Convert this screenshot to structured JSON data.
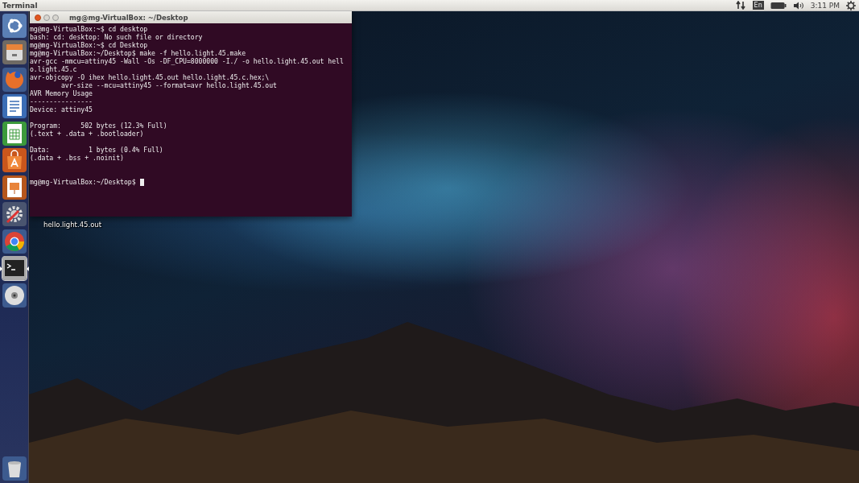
{
  "top_bar": {
    "app_title": "Terminal",
    "keyboard_layout": "En",
    "clock": "3:11 PM"
  },
  "launcher": {
    "items": [
      {
        "kind": "dash",
        "running": false
      },
      {
        "kind": "files",
        "running": false
      },
      {
        "kind": "firefox",
        "running": false
      },
      {
        "kind": "writer",
        "running": false
      },
      {
        "kind": "calc",
        "running": false
      },
      {
        "kind": "software",
        "running": false
      },
      {
        "kind": "impress",
        "running": false
      },
      {
        "kind": "settings",
        "running": false
      },
      {
        "kind": "chrome",
        "running": false
      },
      {
        "kind": "terminal",
        "running": true
      },
      {
        "kind": "dvd",
        "running": false
      },
      {
        "kind": "trash",
        "running": false
      }
    ]
  },
  "desktop": {
    "icons": [
      {
        "label": "hello.light.45.out"
      }
    ]
  },
  "terminal_window": {
    "title": "mg@mg-VirtualBox: ~/Desktop",
    "focused": true,
    "blocks": [
      {
        "kind": "top",
        "lines": [
          "mg@mg-VirtualBox:~$ cd desktop",
          "bash: cd: desktop: No such file or directory",
          "mg@mg-VirtualBox:~$ cd Desktop",
          "mg@mg-VirtualBox:~/Desktop$ make -f hello.light.45.make",
          "avr-gcc -mmcu=attiny45 -Wall -Os -DF_CPU=8000000 -I./ -o hello.light.45.out hell",
          "o.light.45.c",
          "avr-objcopy -O ihex hello.light.45.out hello.light.45.c.hex;\\",
          "        avr-size --mcu=attiny45 --format=avr hello.light.45.out",
          "AVR Memory Usage",
          "----------------",
          "Device: attiny45"
        ]
      },
      {
        "kind": "spaced",
        "lines": [
          "Program:     502 bytes (12.3% Full)",
          "(.text + .data + .bootloader)"
        ]
      },
      {
        "kind": "spaced",
        "lines": [
          "Data:          1 bytes (0.4% Full)",
          "(.data + .bss + .noinit)"
        ]
      },
      {
        "kind": "wide_spaced",
        "lines": [
          "mg@mg-VirtualBox:~/Desktop$ "
        ]
      }
    ],
    "cursor": true
  }
}
